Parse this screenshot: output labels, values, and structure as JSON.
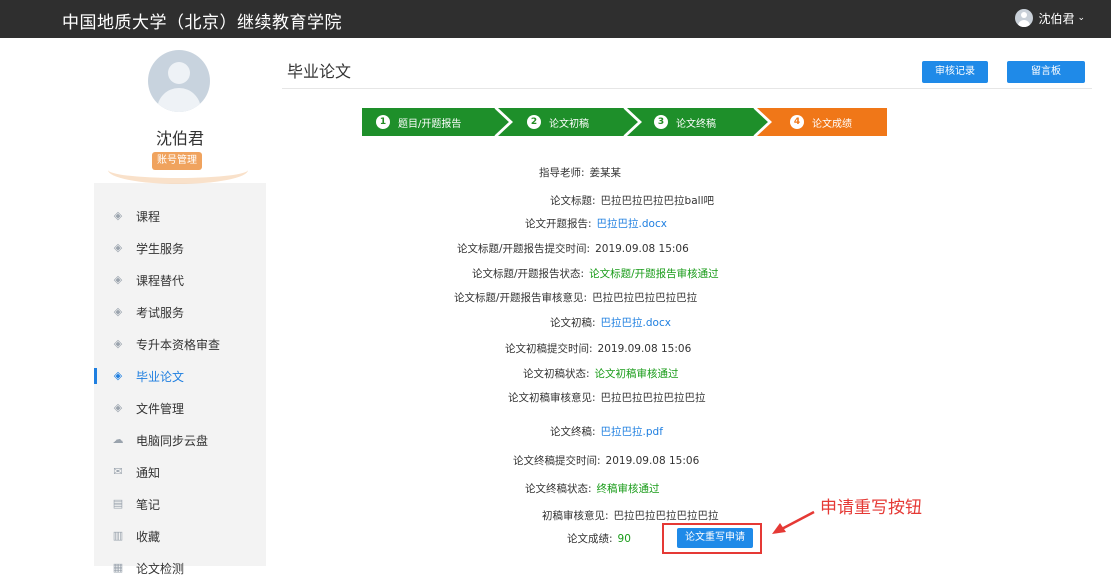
{
  "header": {
    "brand": "中国地质大学（北京）继续教育学院",
    "user": "沈伯君"
  },
  "profile": {
    "name": "沈伯君",
    "account_button": "账号管理"
  },
  "nav": [
    {
      "label": "课程",
      "icon": "graduation-cap-icon"
    },
    {
      "label": "学生服务",
      "icon": "graduation-cap-icon"
    },
    {
      "label": "课程替代",
      "icon": "graduation-cap-icon"
    },
    {
      "label": "考试服务",
      "icon": "graduation-cap-icon"
    },
    {
      "label": "专升本资格审查",
      "icon": "graduation-cap-icon"
    },
    {
      "label": "毕业论文",
      "icon": "graduation-cap-icon",
      "active": true
    },
    {
      "label": "文件管理",
      "icon": "graduation-cap-icon"
    },
    {
      "label": "电脑同步云盘",
      "icon": "cloud-icon"
    },
    {
      "label": "通知",
      "icon": "mail-icon"
    },
    {
      "label": "笔记",
      "icon": "note-icon"
    },
    {
      "label": "收藏",
      "icon": "book-icon"
    },
    {
      "label": "论文检测",
      "icon": "document-icon"
    }
  ],
  "page": {
    "title": "毕业论文",
    "audit_button": "审核记录",
    "message_button": "留言板"
  },
  "steps": [
    {
      "num": "1",
      "label": "题目/开题报告",
      "color": "#1e8f2a"
    },
    {
      "num": "2",
      "label": "论文初稿",
      "color": "#1e8f2a"
    },
    {
      "num": "3",
      "label": "论文终稿",
      "color": "#1e8f2a"
    },
    {
      "num": "4",
      "label": "论文成绩",
      "color": "#f07718"
    }
  ],
  "details": {
    "advisor_label": "指导老师:",
    "advisor": "姜某某",
    "title_label": "论文标题:",
    "title": "巴拉巴拉巴拉巴拉ball吧",
    "proposal_label": "论文开题报告:",
    "proposal": "巴拉巴拉.docx",
    "proposal_time_label": "论文标题/开题报告提交时间:",
    "proposal_time": "2019.09.08 15:06",
    "proposal_status_label": "论文标题/开题报告状态:",
    "proposal_status": "论文标题/开题报告审核通过",
    "proposal_opinion_label": "论文标题/开题报告审核意见:",
    "proposal_opinion": "巴拉巴拉巴拉巴拉巴拉",
    "draft_label": "论文初稿:",
    "draft": "巴拉巴拉.docx",
    "draft_time_label": "论文初稿提交时间:",
    "draft_time": "2019.09.08 15:06",
    "draft_status_label": "论文初稿状态:",
    "draft_status": "论文初稿审核通过",
    "draft_opinion_label": "论文初稿审核意见:",
    "draft_opinion": "巴拉巴拉巴拉巴拉巴拉",
    "final_label": "论文终稿:",
    "final": "巴拉巴拉.pdf",
    "final_time_label": "论文终稿提交时间:",
    "final_time": "2019.09.08 15:06",
    "final_status_label": "论文终稿状态:",
    "final_status": "终稿审核通过",
    "final_opinion_label": "初稿审核意见:",
    "final_opinion": "巴拉巴拉巴拉巴拉巴拉",
    "score_label": "论文成绩:",
    "score": "90",
    "rewrite_button": "论文重写申请"
  },
  "annotation": {
    "text": "申请重写按钮",
    "color": "#e53935"
  }
}
